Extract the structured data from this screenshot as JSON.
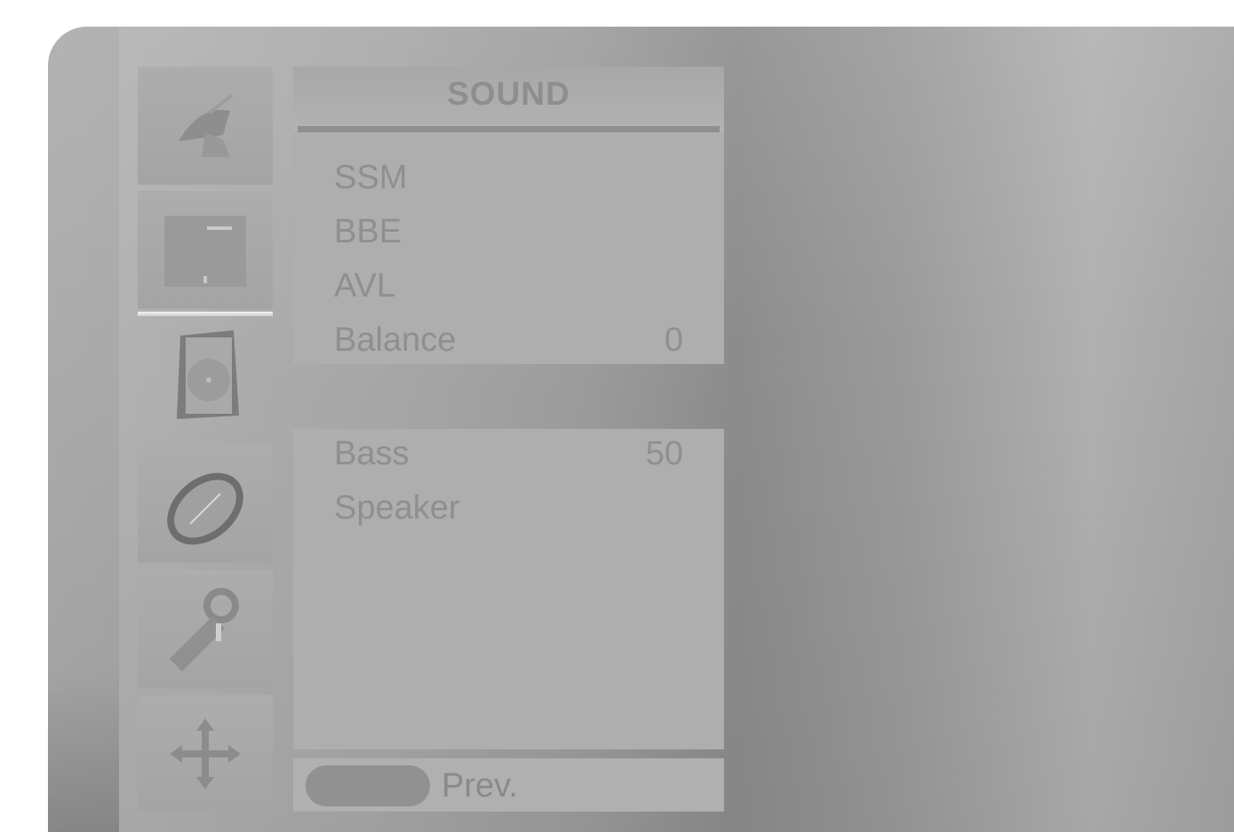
{
  "menu": {
    "title": "SOUND",
    "items": [
      {
        "label": "SSM",
        "value": ""
      },
      {
        "label": "BBE",
        "value": ""
      },
      {
        "label": "AVL",
        "value": ""
      },
      {
        "label": "Balance",
        "value": "0"
      },
      {
        "label": "Bass",
        "value": "50"
      },
      {
        "label": "Speaker",
        "value": ""
      }
    ],
    "footer": {
      "prev_label": "Prev."
    }
  },
  "sidebar": {
    "icons": [
      "satellite-dish-icon",
      "picture-icon",
      "speaker-icon",
      "time-icon",
      "special-key-icon",
      "screen-move-icon"
    ],
    "active_index": 2
  },
  "colors": {
    "panel": "#aeaeae",
    "text": "#8f8f8f",
    "background": "#a0a0a0"
  }
}
